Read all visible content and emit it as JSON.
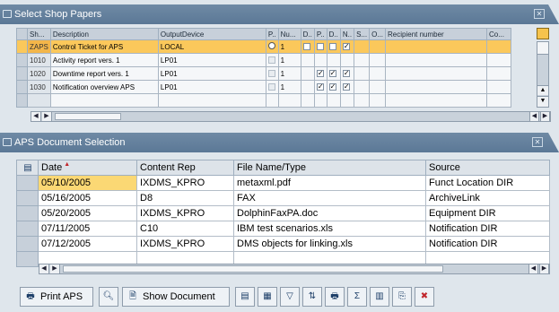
{
  "window": {
    "title_top": "Select Shop Papers",
    "title_bottom": "APS Document Selection"
  },
  "shop_table": {
    "headers": [
      "Sh...",
      "Description",
      "OutputDevice",
      "P..",
      "Nu...",
      "D..",
      "P..",
      "D..",
      "N..",
      "S...",
      "O...",
      "Recipient number",
      "Co..."
    ],
    "rows": [
      {
        "key": "ZAPS",
        "desc": "Control Ticket for APS",
        "device": "LOCAL",
        "num": "1",
        "checks": [
          false,
          false,
          false,
          true
        ],
        "selected": true
      },
      {
        "key": "1010",
        "desc": "Activity report vers. 1",
        "device": "LP01",
        "num": "1",
        "checks": [
          false,
          false,
          false,
          false
        ],
        "selected": false
      },
      {
        "key": "1020",
        "desc": "Downtime report vers. 1",
        "device": "LP01",
        "num": "1",
        "checks": [
          false,
          true,
          true,
          true
        ],
        "selected": false
      },
      {
        "key": "1030",
        "desc": "Notification overview APS",
        "device": "LP01",
        "num": "1",
        "checks": [
          false,
          true,
          true,
          true
        ],
        "selected": false
      }
    ]
  },
  "doc_table": {
    "headers": [
      "Date",
      "Content Rep",
      "File Name/Type",
      "Source"
    ],
    "rows": [
      {
        "date": "05/10/2005",
        "rep": "IXDMS_KPRO",
        "file": "metaxml.pdf",
        "source": "Funct Location DIR",
        "selected": true
      },
      {
        "date": "05/16/2005",
        "rep": "D8",
        "file": "FAX",
        "source": "ArchiveLink",
        "selected": false
      },
      {
        "date": "05/20/2005",
        "rep": "IXDMS_KPRO",
        "file": "DolphinFaxPA.doc",
        "source": "Equipment DIR",
        "selected": false
      },
      {
        "date": "07/11/2005",
        "rep": "C10",
        "file": "IBM test scenarios.xls",
        "source": "Notification DIR",
        "selected": false
      },
      {
        "date": "07/12/2005",
        "rep": "IXDMS_KPRO",
        "file": "DMS objects for linking.xls",
        "source": "Notification DIR",
        "selected": false
      }
    ]
  },
  "toolbar": {
    "print_aps": "Print APS",
    "show_document": "Show Document"
  },
  "colors": {
    "header_bar": "#5b7896",
    "selection": "#fbc85b",
    "background": "#dfe6ec"
  }
}
